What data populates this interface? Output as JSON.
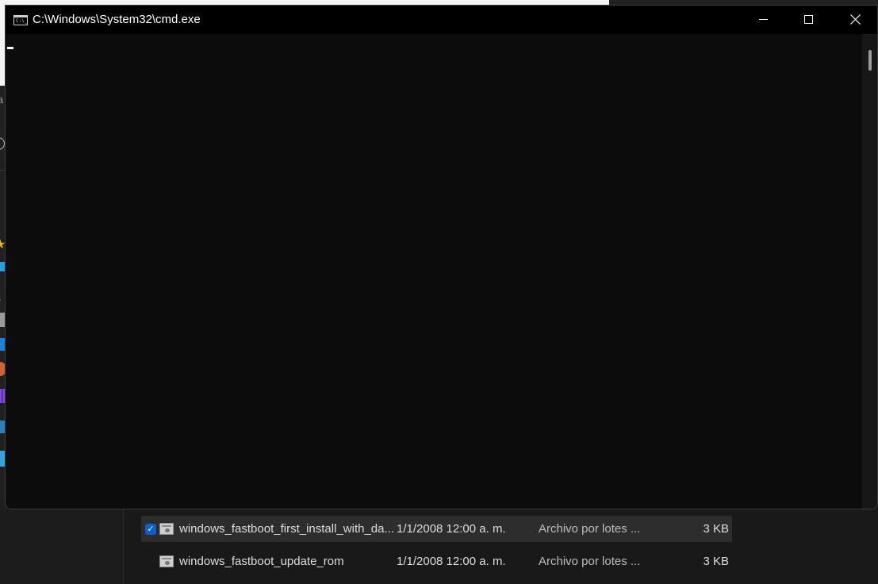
{
  "cmd_window": {
    "title": "C:\\Windows\\System32\\cmd.exe",
    "icon": "command-prompt-icon",
    "console_text": "",
    "buttons": {
      "minimize_icon": "minimize-icon",
      "maximize_icon": "maximize-icon",
      "close_icon": "close-icon"
    }
  },
  "explorer": {
    "files": [
      {
        "name": "windows_fastboot_first_install_with_da...",
        "date": "1/1/2008 12:00 a. m.",
        "type": "Archivo por lotes ...",
        "size": "3 KB",
        "selected": true
      },
      {
        "name": "windows_fastboot_update_rom",
        "date": "1/1/2008 12:00 a. m.",
        "type": "Archivo por lotes ...",
        "size": "3 KB",
        "selected": false
      }
    ],
    "left_peek_text": "ia"
  },
  "colors": {
    "console_background": "#0c0c0c",
    "titlebar_background": "#000000",
    "explorer_background": "#191919",
    "selection_background": "#2d2d2d",
    "checkbox_accent": "#0a60c8"
  }
}
